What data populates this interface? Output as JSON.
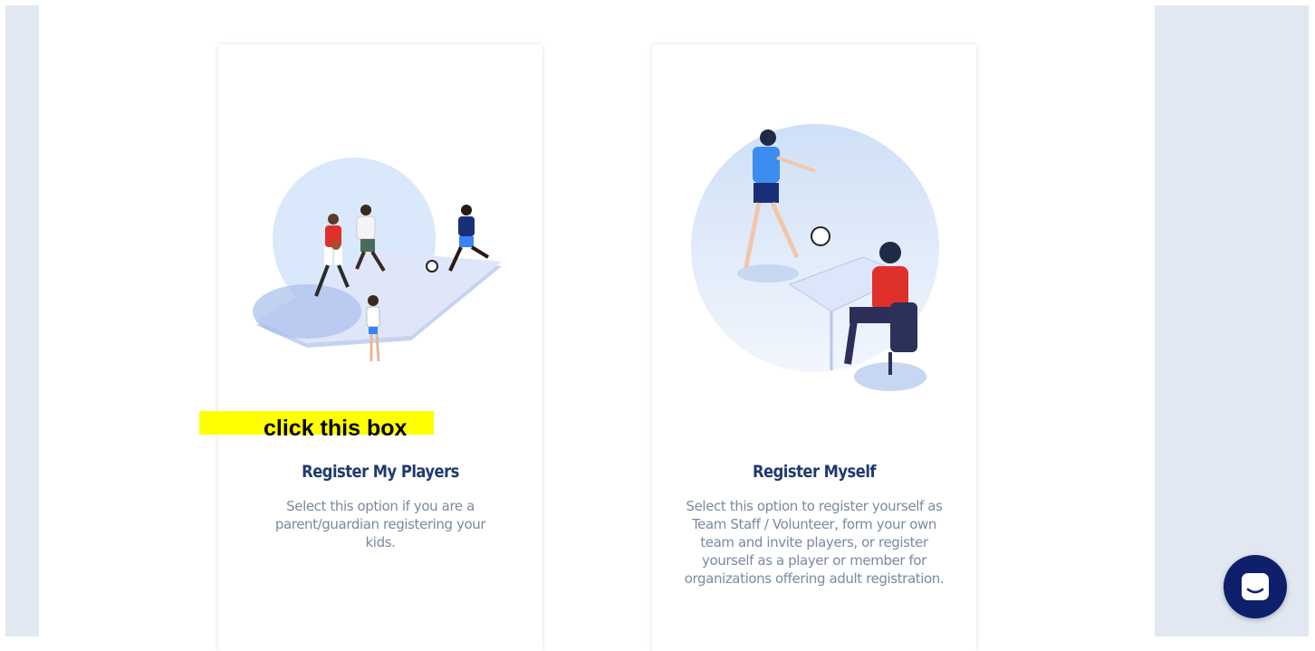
{
  "cards": [
    {
      "title": "Register My Players",
      "description": "Select this option if you are a parent/guardian registering your kids."
    },
    {
      "title": "Register Myself",
      "description": "Select this option to register yourself as Team Staff / Volunteer, form your own team and invite players, or register yourself as a player or member for organizations offering adult registration."
    }
  ],
  "hint": {
    "text": "click this box",
    "color": "#ffff00"
  },
  "chat": {
    "icon": "chat-icon",
    "color": "#0e1f6b"
  },
  "colors": {
    "page_background": "#e1e8f2",
    "title": "#1f3a6e",
    "description": "#7a8aa0"
  }
}
